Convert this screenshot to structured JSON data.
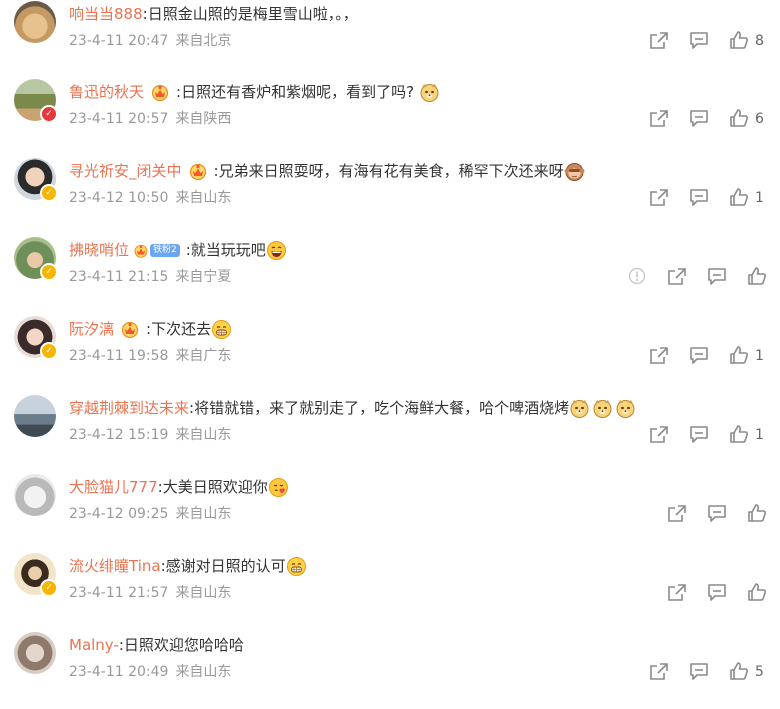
{
  "comments": [
    {
      "user": "响当当888",
      "text": ":日照金山照的是梅里雪山啦，。，",
      "date": "23-4-11 20:47",
      "location": "来自北京",
      "likes": "8"
    },
    {
      "user": "鲁迅的秋天",
      "text": ":日照还有香炉和紫烟呢，看到了吗?",
      "date": "23-4-11 20:57",
      "location": "来自陕西",
      "likes": "6"
    },
    {
      "user": "寻光祈安_闭关中",
      "text": ":兄弟来日照耍呀，有海有花有美食，稀罕下次还来呀",
      "date": "23-4-12 10:50",
      "location": "来自山东",
      "likes": "1"
    },
    {
      "user": "拂晓哨位",
      "fan_badge": "铁粉2",
      "text": ":就当玩玩吧",
      "date": "23-4-11 21:15",
      "location": "来自宁夏",
      "likes": ""
    },
    {
      "user": "阮汐漓",
      "text": ":下次还去",
      "date": "23-4-11 19:58",
      "location": "来自广东",
      "likes": "1"
    },
    {
      "user": "穿越荆棘到达未来",
      "text": ":将错就错，来了就别走了，吃个海鲜大餐，哈个啤酒烧烤",
      "date": "23-4-12 15:19",
      "location": "来自山东",
      "likes": "1"
    },
    {
      "user": "大脸猫儿777",
      "text": ":大美日照欢迎你",
      "date": "23-4-12 09:25",
      "location": "来自山东",
      "likes": ""
    },
    {
      "user": "流火绯瞳Tina",
      "text": ":感谢对日照的认可",
      "date": "23-4-11 21:57",
      "location": "来自山东",
      "likes": ""
    },
    {
      "user": "Malny-",
      "text": ":日照欢迎您哈哈哈",
      "date": "23-4-11 20:49",
      "location": "来自山东",
      "likes": "5"
    }
  ],
  "icons": {
    "share": "share-icon",
    "comment": "comment-icon",
    "like": "thumbs-up-icon",
    "report": "report-icon",
    "crown": "crown-badge-icon",
    "emoji_doge": "doge-emoji-icon",
    "emoji_laugh": "laugh-emoji-icon",
    "emoji_grin": "grin-emoji-icon",
    "emoji_monkey": "monkey-emoji-icon",
    "emoji_kiss": "kiss-emoji-icon"
  },
  "colors": {
    "username": "#eb7350",
    "meta": "#999999",
    "icon": "#8a8a8a"
  }
}
